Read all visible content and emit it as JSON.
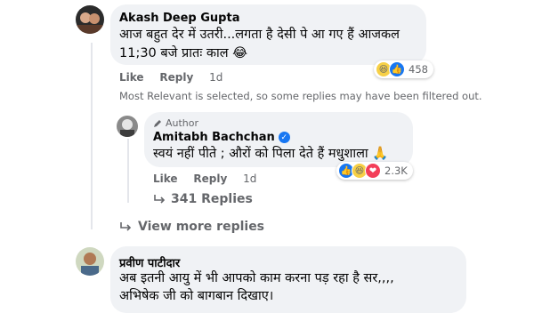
{
  "comments": {
    "c1": {
      "author": "Akash Deep Gupta",
      "line1": "आज बहुत देर में उतरी...लगता है देसी पे आ गए हैं आजकल",
      "line2": "11;30 बजे प्रातः काल 😂",
      "actions": {
        "like": "Like",
        "reply": "Reply",
        "time": "1d"
      },
      "reaction_count": "458"
    },
    "filter_note": "Most Relevant is selected, so some replies may have been filtered out.",
    "reply": {
      "author_label": "Author",
      "author": "Amitabh Bachchan",
      "text": "स्वयं नहीं पीते ; औरों को पिला देते हैं मधुशाला 🙏",
      "actions": {
        "like": "Like",
        "reply": "Reply",
        "time": "1d"
      },
      "reaction_count": "2.3K"
    },
    "replies_link": "341 Replies",
    "view_more": "View more replies",
    "c2": {
      "author": "प्रवीण पाटीदार",
      "line1": "अब इतनी आयु में भी आपको काम करना पड़ रहा है सर,,,,",
      "line2": "अभिषेक जी को बागबान दिखाए।"
    }
  },
  "icons": {
    "reactions": [
      "haha-icon",
      "like-icon",
      "love-icon"
    ],
    "pen": "pen-icon",
    "verified": "verified-badge-icon",
    "reply_arrow": "reply-arrow-icon"
  },
  "colors": {
    "bubble": "#f0f2f5",
    "secondary_text": "#65676b",
    "like_blue": "#1877f2",
    "love_red": "#f33e58",
    "haha_yellow": "#f7d046"
  }
}
